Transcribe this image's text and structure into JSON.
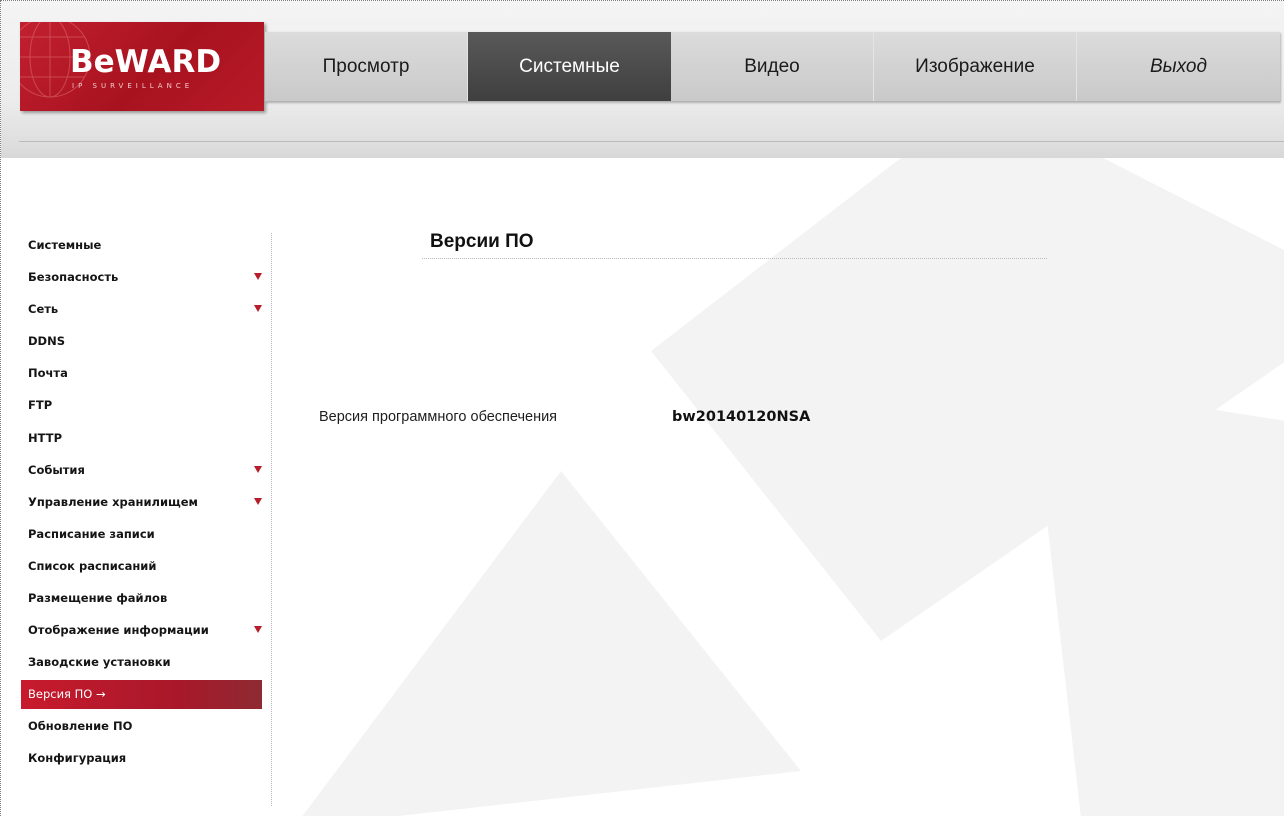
{
  "brand": {
    "logo_text": "BeWARD",
    "logo_subtext": "IP SURVEILLANCE",
    "color": "#b7182a"
  },
  "nav": {
    "items": [
      {
        "label": "Просмотр"
      },
      {
        "label": "Системные"
      },
      {
        "label": "Видео"
      },
      {
        "label": "Изображение"
      },
      {
        "label": "Выход"
      }
    ],
    "active": "Системные"
  },
  "sidebar": {
    "items": [
      {
        "label": "Системные",
        "expandable": false
      },
      {
        "label": "Безопасность",
        "expandable": true
      },
      {
        "label": "Сеть",
        "expandable": true
      },
      {
        "label": "DDNS",
        "expandable": false
      },
      {
        "label": "Почта",
        "expandable": false
      },
      {
        "label": "FTP",
        "expandable": false
      },
      {
        "label": "HTTP",
        "expandable": false
      },
      {
        "label": "События",
        "expandable": true
      },
      {
        "label": "Управление хранилищем",
        "expandable": true
      },
      {
        "label": "Расписание записи",
        "expandable": false
      },
      {
        "label": "Список расписаний",
        "expandable": false
      },
      {
        "label": "Размещение файлов",
        "expandable": false
      },
      {
        "label": "Отображение информации",
        "expandable": true
      },
      {
        "label": "Заводские установки",
        "expandable": false
      },
      {
        "label": "Версия ПО →",
        "expandable": false,
        "active": true
      },
      {
        "label": "Обновление ПО",
        "expandable": false
      },
      {
        "label": "Конфигурация",
        "expandable": false
      }
    ]
  },
  "content": {
    "title": "Версии ПО",
    "firmware_label": "Версия программного обеспечения",
    "firmware_value": "bw20140120NSA"
  }
}
